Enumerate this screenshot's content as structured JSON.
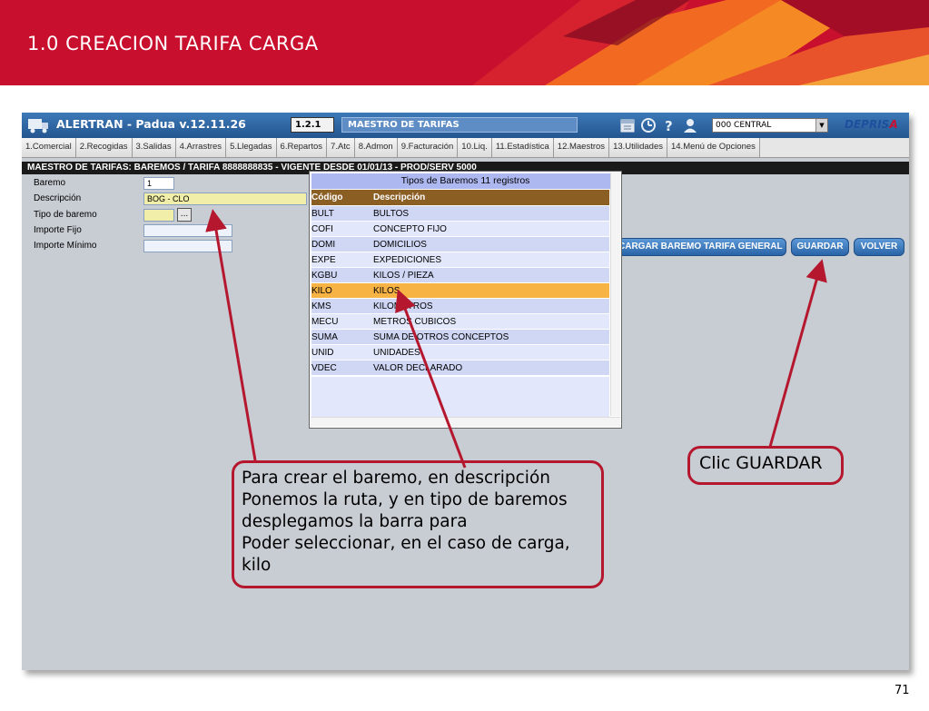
{
  "slide": {
    "title": "1.0 CREACION TARIFA CARGA",
    "page_number": "71",
    "banner_color": "#c8102e"
  },
  "window": {
    "app_title": "ALERTRAN - Padua  v.12.11.26",
    "screen_code": "1.2.1",
    "screen_name": "MAESTRO DE TARIFAS",
    "toolbar_icons": [
      "calendar-icon",
      "clock-icon",
      "help-icon",
      "user-icon"
    ],
    "branch_select": "000 CENTRAL",
    "brand_logo_prefix": "DEPRIS",
    "brand_logo_suffix": "A"
  },
  "menu": [
    "1.Comercial",
    "2.Recogidas",
    "3.Salidas",
    "4.Arrastres",
    "5.Llegadas",
    "6.Repartos",
    "7.Atc",
    "8.Admon",
    "9.Facturación",
    "10.Liq.",
    "11.Estadística",
    "12.Maestros",
    "13.Utilidades",
    "14.Menú de Opciones"
  ],
  "breadcrumb": "MAESTRO DE TARIFAS: BAREMOS  /  TARIFA 8888888835  -  VIGENTE DESDE 01/01/13  -  PROD/SERV 5000",
  "form": {
    "baremo_label": "Baremo",
    "baremo_value": "1",
    "descripcion_label": "Descripción",
    "descripcion_value": "BOG - CLO",
    "tipo_label": "Tipo de baremo",
    "tipo_value": "",
    "tipo_button": "...",
    "importe_fijo_label": "Importe Fijo",
    "importe_fijo_value": "",
    "importe_minimo_label": "Importe Mínimo",
    "importe_minimo_value": ""
  },
  "actions": {
    "cargar": "CARGAR BAREMO TARIFA GENERAL",
    "guardar": "GUARDAR",
    "volver": "VOLVER"
  },
  "popup": {
    "title": "Tipos de Baremos 11 registros",
    "col_code": "Código",
    "col_desc": "Descripción",
    "selected_index": 5,
    "rows": [
      {
        "code": "BULT",
        "desc": "BULTOS"
      },
      {
        "code": "COFI",
        "desc": "CONCEPTO FIJO"
      },
      {
        "code": "DOMI",
        "desc": "DOMICILIOS"
      },
      {
        "code": "EXPE",
        "desc": "EXPEDICIONES"
      },
      {
        "code": "KGBU",
        "desc": "KILOS / PIEZA"
      },
      {
        "code": "KILO",
        "desc": "KILOS"
      },
      {
        "code": "KMS",
        "desc": "KILOMETROS"
      },
      {
        "code": "MECU",
        "desc": "METROS CUBICOS"
      },
      {
        "code": "SUMA",
        "desc": "SUMA DE OTROS CONCEPTOS"
      },
      {
        "code": "UNID",
        "desc": "UNIDADES"
      },
      {
        "code": "VDEC",
        "desc": "VALOR DECLARADO"
      }
    ],
    "selected_color": "#f7b445"
  },
  "callouts": {
    "instructions": [
      "Para crear el baremo, en descripción",
      "Ponemos la ruta, y en tipo de baremos",
      "desplegamos la barra para",
      "Poder seleccionar, en el caso de carga,",
      "kilo"
    ],
    "guardar_hint": "Clic GUARDAR",
    "accent_color": "#b5182e"
  }
}
